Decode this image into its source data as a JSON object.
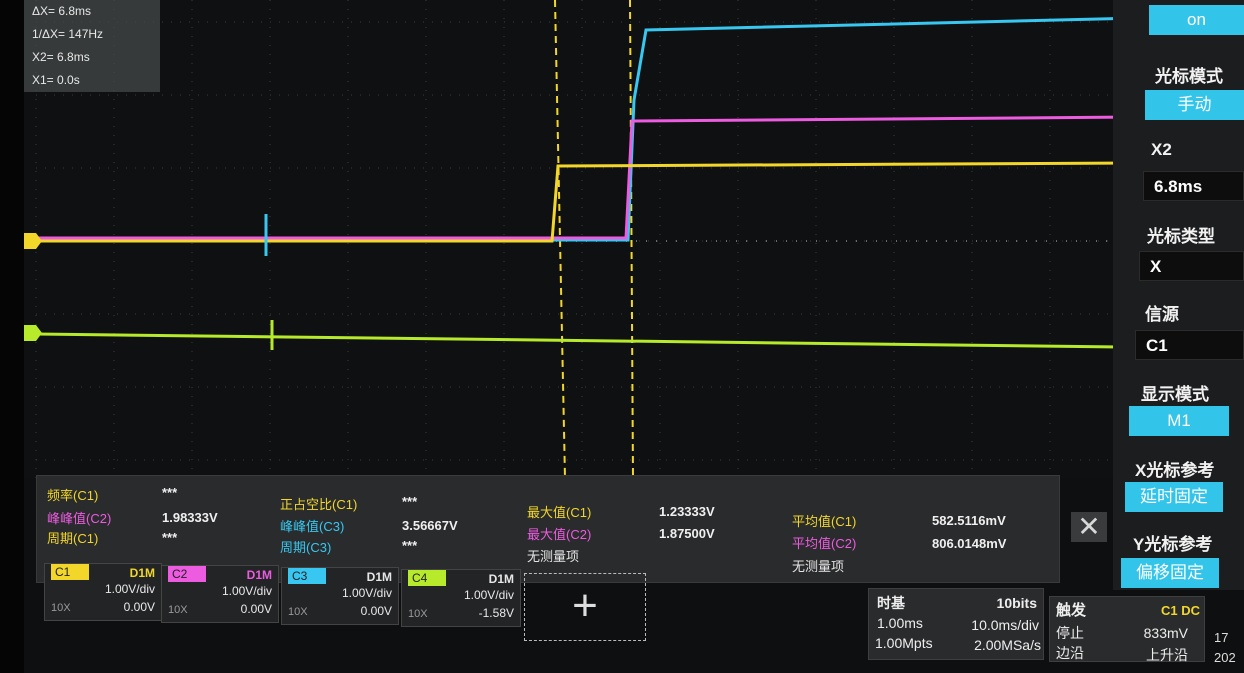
{
  "cursor_readout": {
    "delta_x": "ΔX= 6.8ms",
    "inv_delta_x": "1/ΔX= 147Hz",
    "x2": "X2= 6.8ms",
    "x1": "X1= 0.0s"
  },
  "side_menu": {
    "toggle_value": "on",
    "cursor_mode_label": "光标模式",
    "cursor_mode_value": "手动",
    "x2_label": "X2",
    "x2_value": "6.8ms",
    "cursor_type_label": "光标类型",
    "cursor_type_value": "X",
    "source_label": "信源",
    "source_value": "C1",
    "display_mode_label": "显示模式",
    "display_mode_value": "M1",
    "x_cursor_ref_label": "X光标参考",
    "x_cursor_ref_value": "延时固定",
    "y_cursor_ref_label": "Y光标参考",
    "y_cursor_ref_value": "偏移固定"
  },
  "measurements": {
    "freq_c1_label": "频率(C1)",
    "freq_c1_value": "***",
    "pp_c2_label": "峰峰值(C2)",
    "pp_c2_value": "1.98333V",
    "period_c1_label": "周期(C1)",
    "period_c1_value": "***",
    "duty_c1_label": "正占空比(C1)",
    "duty_c1_value": "***",
    "pp_c3_label": "峰峰值(C3)",
    "pp_c3_value": "3.56667V",
    "period_c3_label": "周期(C3)",
    "period_c3_value": "***",
    "max_c1_label": "最大值(C1)",
    "max_c1_value": "1.23333V",
    "max_c2_label": "最大值(C2)",
    "max_c2_value": "1.87500V",
    "none_label_1": "无测量项",
    "avg_c1_label": "平均值(C1)",
    "avg_c1_value": "582.5116mV",
    "avg_c2_label": "平均值(C2)",
    "avg_c2_value": "806.0148mV",
    "none_label_2": "无测量项"
  },
  "channels": [
    {
      "tag": "C1",
      "mode": "D1M",
      "scale": "1.00V/div",
      "probe": "10X",
      "offset": "0.00V",
      "color": "#f2d72a"
    },
    {
      "tag": "C2",
      "mode": "D1M",
      "scale": "1.00V/div",
      "probe": "10X",
      "offset": "0.00V",
      "color": "#ec5be0"
    },
    {
      "tag": "C3",
      "mode": "D1M",
      "scale": "1.00V/div",
      "probe": "10X",
      "offset": "0.00V",
      "color": "#37c7f0"
    },
    {
      "tag": "C4",
      "mode": "D1M",
      "scale": "1.00V/div",
      "probe": "10X",
      "offset": "-1.58V",
      "color": "#b6ea2a"
    }
  ],
  "timebase": {
    "label": "时基",
    "bits": "10bits",
    "time_div_1": "1.00ms",
    "time_div_2": "10.0ms/div",
    "memory": "1.00Mpts",
    "sample_rate": "2.00MSa/s"
  },
  "trigger": {
    "label": "触发",
    "source": "C1 DC",
    "state": "停止",
    "level": "833mV",
    "type": "边沿",
    "slope": "上升沿"
  },
  "clock": {
    "line1": "17",
    "line2": "202"
  },
  "colors": {
    "c1": "#f2d72a",
    "c2": "#ec5be0",
    "c3": "#37c7f0",
    "c4": "#b6ea2a"
  }
}
